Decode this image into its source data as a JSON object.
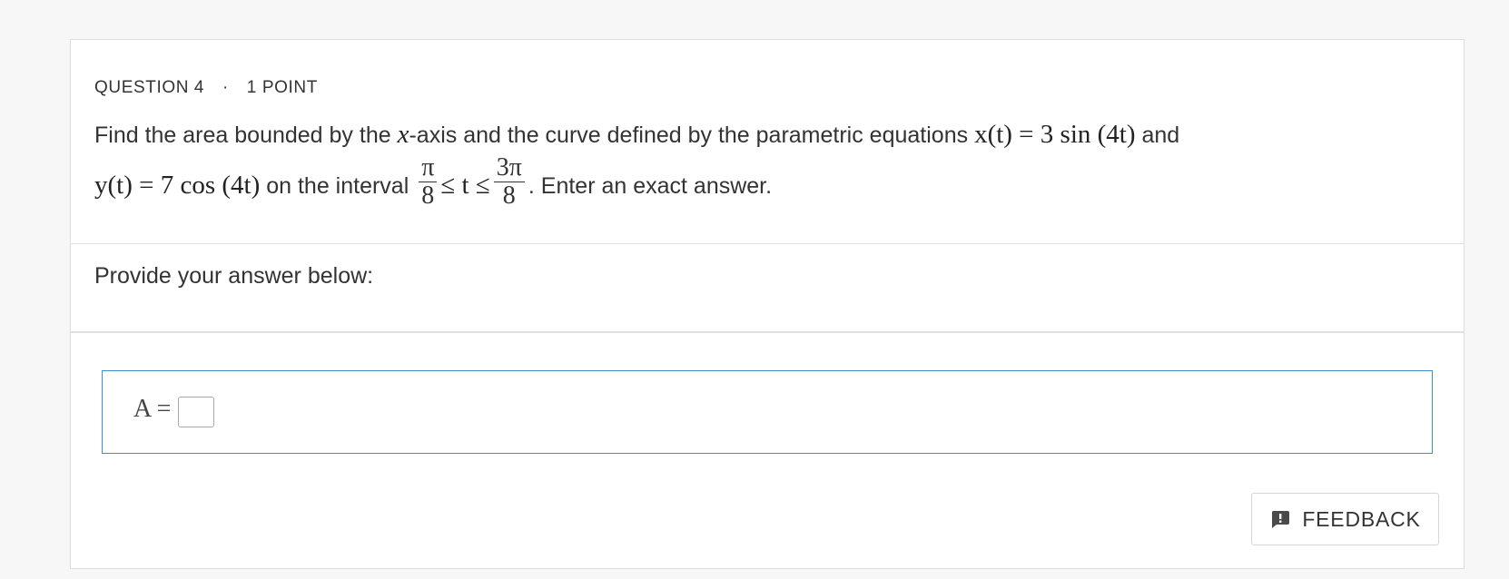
{
  "question": {
    "number_label": "QUESTION 4",
    "separator": "·",
    "points_label": "1 POINT",
    "text_part1": "Find the area bounded by the ",
    "x_var": "x",
    "text_part2": "-axis and the curve defined by the parametric equations ",
    "eq_x": "x(t) = 3 sin (4t)",
    "text_part3": " and",
    "eq_y": "y(t) = 7 cos (4t)",
    "text_part4": " on the interval ",
    "frac1_num": "π",
    "frac1_den": "8",
    "ineq": "≤ t ≤",
    "frac2_num": "3π",
    "frac2_den": "8",
    "text_part5": ". Enter an exact answer."
  },
  "answer_section": {
    "prompt": "Provide your answer below:",
    "label": "A =",
    "value": ""
  },
  "feedback": {
    "label": "FEEDBACK",
    "icon": "feedback-icon"
  },
  "colors": {
    "input_border": "#3d8fd1",
    "background": "#f7f7f7"
  }
}
